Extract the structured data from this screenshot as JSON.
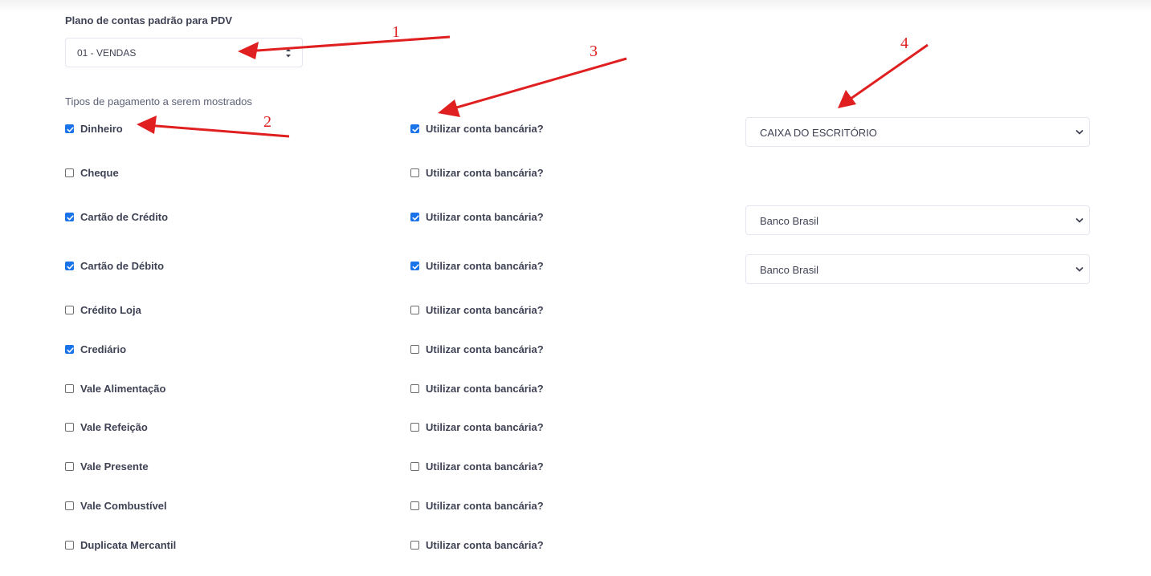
{
  "plano": {
    "label": "Plano de contas padrão para PDV",
    "selected": "01 - VENDAS"
  },
  "tipos": {
    "label": "Tipos de pagamento a serem mostrados",
    "conta_label": "Utilizar conta bancária?",
    "items": [
      {
        "name": "Dinheiro",
        "checked": true,
        "conta": true,
        "banco": "CAIXA DO ESCRITÓRIO"
      },
      {
        "name": "Cheque",
        "checked": false,
        "conta": false,
        "banco": null
      },
      {
        "name": "Cartão de Crédito",
        "checked": true,
        "conta": true,
        "banco": "Banco Brasil"
      },
      {
        "name": "Cartão de Débito",
        "checked": true,
        "conta": true,
        "banco": "Banco Brasil"
      },
      {
        "name": "Crédito Loja",
        "checked": false,
        "conta": false,
        "banco": null
      },
      {
        "name": "Crediário",
        "checked": true,
        "conta": false,
        "banco": null
      },
      {
        "name": "Vale Alimentação",
        "checked": false,
        "conta": false,
        "banco": null
      },
      {
        "name": "Vale Refeição",
        "checked": false,
        "conta": false,
        "banco": null
      },
      {
        "name": "Vale Presente",
        "checked": false,
        "conta": false,
        "banco": null
      },
      {
        "name": "Vale Combustível",
        "checked": false,
        "conta": false,
        "banco": null
      },
      {
        "name": "Duplicata Mercantil",
        "checked": false,
        "conta": false,
        "banco": null
      }
    ]
  },
  "annotations": {
    "color": "#e02020",
    "numbers": [
      "1",
      "2",
      "3",
      "4"
    ]
  }
}
